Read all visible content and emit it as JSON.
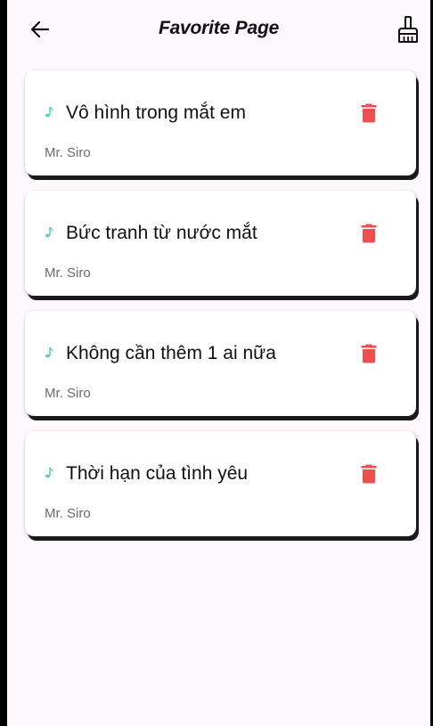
{
  "app_bar": {
    "title": "Favorite Page",
    "back_icon": "arrow-left-icon",
    "action_icon": "cleaning-brush-icon"
  },
  "colors": {
    "background": "#fcf8fc",
    "card": "#ffffff",
    "accent_music": "#5fd3b7",
    "delete": "#ef4f4f",
    "title_text": "#111111",
    "artist_text": "#6b6b6b"
  },
  "favorites": [
    {
      "title": "Vô hình trong mắt em",
      "artist": "Mr. Siro",
      "leading_icon": "music-note-icon",
      "trailing_icon": "trash-icon"
    },
    {
      "title": "Bức tranh từ nước mắt",
      "artist": "Mr. Siro",
      "leading_icon": "music-note-icon",
      "trailing_icon": "trash-icon"
    },
    {
      "title": "Không cần thêm 1 ai nữa",
      "artist": "Mr. Siro",
      "leading_icon": "music-note-icon",
      "trailing_icon": "trash-icon"
    },
    {
      "title": "Thời hạn của tình yêu",
      "artist": "Mr. Siro",
      "leading_icon": "music-note-icon",
      "trailing_icon": "trash-icon"
    }
  ]
}
